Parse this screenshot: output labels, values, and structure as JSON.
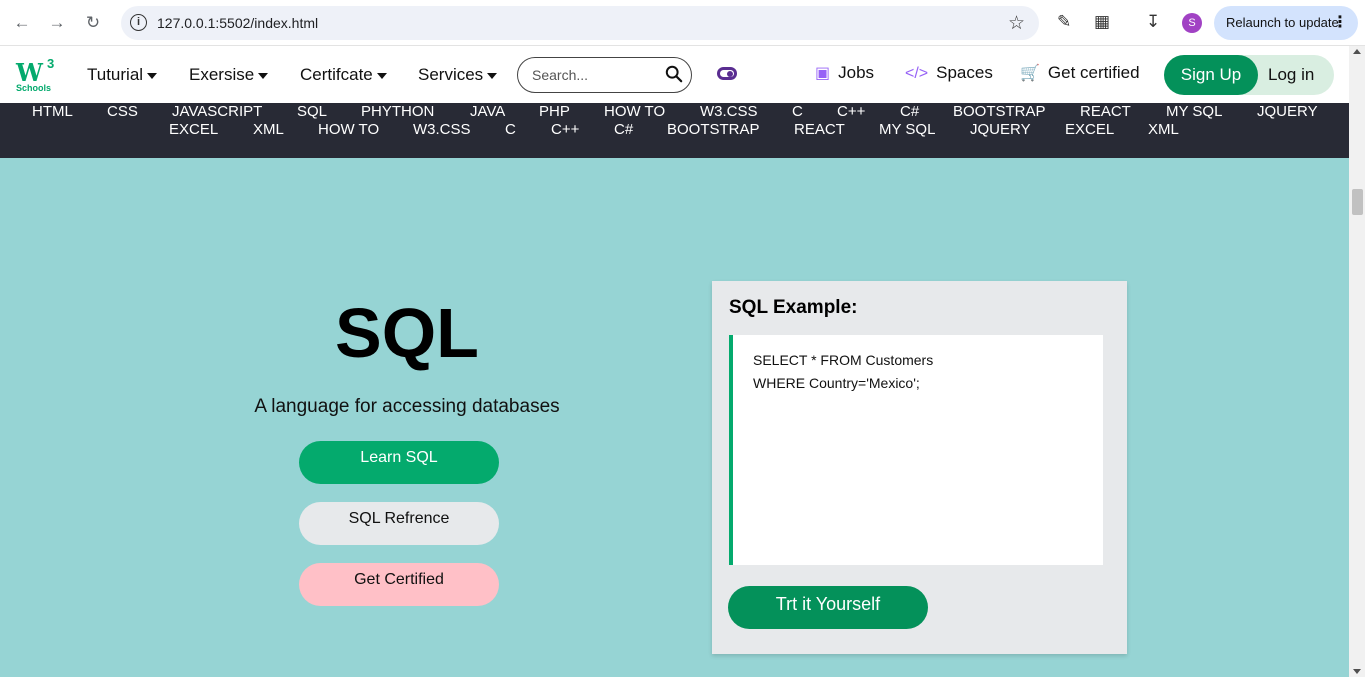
{
  "browser": {
    "url": "127.0.0.1:5502/index.html",
    "relaunch_label": "Relaunch to update",
    "profile_initial": "S"
  },
  "header": {
    "logo": {
      "mark": "W",
      "sup": "3",
      "sub": "Schools"
    },
    "menu": [
      {
        "label": "Tuturial"
      },
      {
        "label": "Exersise"
      },
      {
        "label": "Certifcate"
      },
      {
        "label": "Services"
      }
    ],
    "search": {
      "placeholder": "Search..."
    },
    "links": [
      {
        "label": "Jobs",
        "icon": "briefcase-icon"
      },
      {
        "label": "Spaces",
        "icon": "code-icon"
      },
      {
        "label": "Get certified",
        "icon": "cart-icon"
      }
    ],
    "signup_label": "Sign Up",
    "login_label": "Log in"
  },
  "topics": {
    "row1": [
      "HTML",
      "CSS",
      "JAVASCRIPT",
      "SQL",
      "PHYTHON",
      "JAVA",
      "PHP",
      "HOW TO",
      "W3.CSS",
      "C",
      "C++",
      "C#",
      "BOOTSTRAP",
      "REACT",
      "MY SQL",
      "JQUERY"
    ],
    "row2": [
      "EXCEL",
      "XML",
      "HOW TO",
      "W3.CSS",
      "C",
      "C++",
      "C#",
      "BOOTSTRAP",
      "REACT",
      "MY SQL",
      "JQUERY",
      "EXCEL",
      "XML"
    ]
  },
  "hero": {
    "title": "SQL",
    "subtitle": "A language for accessing databases",
    "buttons": {
      "learn": "Learn SQL",
      "reference": "SQL Refrence",
      "certified": "Get Certified"
    }
  },
  "example": {
    "title": "SQL Example:",
    "code_lines": [
      "SELECT * FROM Customers",
      "WHERE Country='Mexico';"
    ],
    "try_label": "Trt it Yourself"
  },
  "colors": {
    "brand_green": "#04aa6d",
    "dark_green": "#04915a",
    "topics_bg": "#282a35",
    "main_bg": "#96d4d4",
    "accent_purple": "#9763f6"
  }
}
